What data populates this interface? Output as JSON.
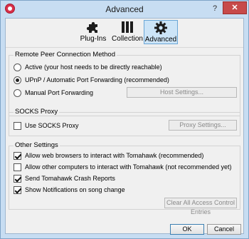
{
  "window": {
    "title": "Advanced",
    "help": "?",
    "close": "✕"
  },
  "toolbar": {
    "tabs": [
      {
        "label": "Plug-Ins",
        "icon": "puzzle-icon"
      },
      {
        "label": "Collection",
        "icon": "library-icon"
      },
      {
        "label": "Advanced",
        "icon": "gear-icon",
        "selected": true
      }
    ]
  },
  "remote": {
    "title": "Remote Peer Connection Method",
    "options": [
      {
        "label": "Active (your host needs to be directly reachable)",
        "checked": false
      },
      {
        "label": "UPnP / Automatic Port Forwarding (recommended)",
        "checked": true
      },
      {
        "label": "Manual Port Forwarding",
        "checked": false
      }
    ],
    "host_settings": "Host Settings..."
  },
  "socks": {
    "title": "SOCKS Proxy",
    "use_label": "Use SOCKS Proxy",
    "use_checked": false,
    "proxy_settings": "Proxy Settings..."
  },
  "other": {
    "title": "Other Settings",
    "options": [
      {
        "label": "Allow web browsers to interact with Tomahawk (recommended)",
        "checked": true
      },
      {
        "label": "Allow other computers to interact with Tomahawk (not recommended yet)",
        "checked": false
      },
      {
        "label": "Send Tomahawk Crash Reports",
        "checked": true
      },
      {
        "label": "Show Notifications on song change",
        "checked": true
      }
    ],
    "clear_entries": "Clear All Access Control Entries"
  },
  "footer": {
    "ok": "OK",
    "cancel": "Cancel"
  }
}
